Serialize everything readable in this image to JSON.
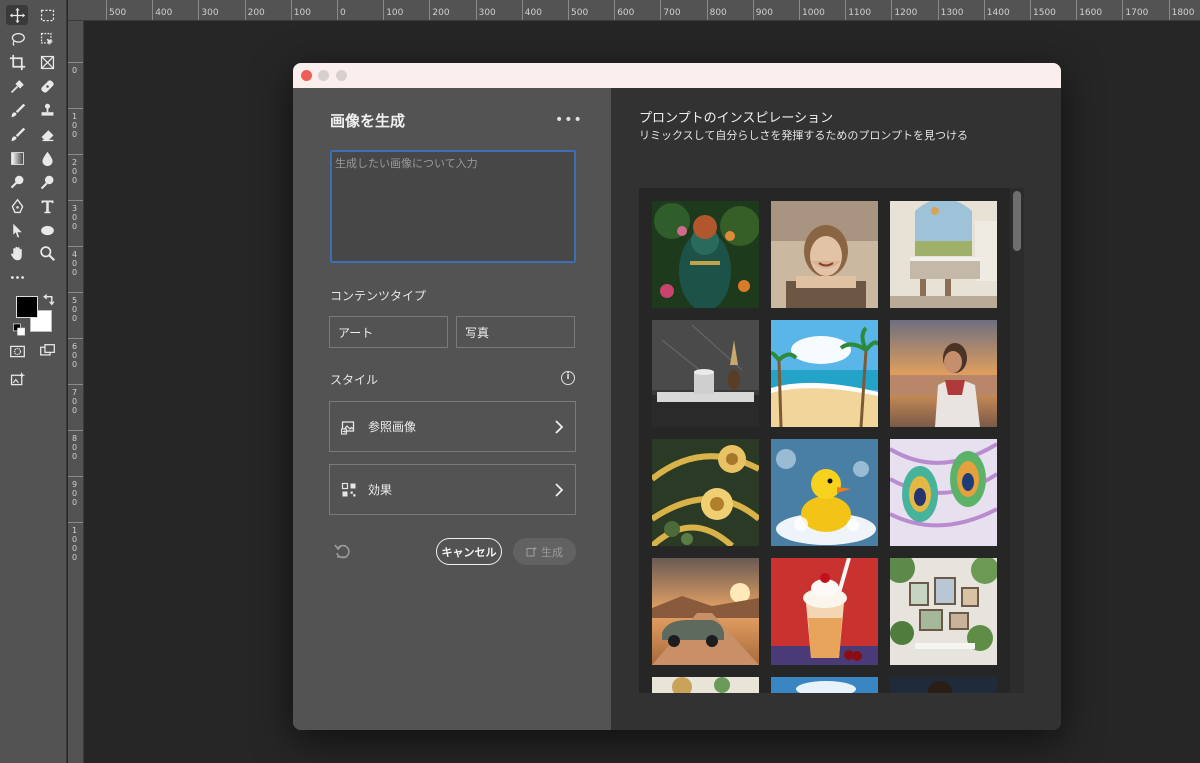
{
  "ruler": {
    "top_labels": [
      "500",
      "400",
      "300",
      "200",
      "100",
      "0",
      "100",
      "200",
      "300",
      "400",
      "500",
      "600",
      "700",
      "800",
      "900",
      "1000",
      "1100",
      "1200",
      "1300",
      "1400",
      "1500",
      "1600",
      "1700",
      "1800"
    ],
    "left_labels": [
      "0",
      "100",
      "200",
      "300",
      "400",
      "500",
      "600",
      "700",
      "800",
      "900",
      "1000"
    ]
  },
  "dialog": {
    "title": "画像を生成",
    "more_label": "•••",
    "prompt_placeholder": "生成したい画像について入力",
    "content_type_label": "コンテンツタイプ",
    "content_types": [
      "アート",
      "写真"
    ],
    "style_label": "スタイル",
    "info_icon_glyph": "i",
    "reference_image_label": "参照画像",
    "effects_label": "効果",
    "cancel_label": "キャンセル",
    "generate_label": "生成"
  },
  "inspiration": {
    "title": "プロンプトのインスピレーション",
    "subtitle": "リミックスして自分らしさを発揮するためのプロンプトを見つける",
    "tiles": [
      "jungle-goddess",
      "vintage-portrait-woman",
      "modern-kitchen",
      "marble-pedestal",
      "tropical-beach",
      "woman-at-beach-sunset",
      "golden-lotus-pattern",
      "rubber-duck-bubbles",
      "peacock-feather-pattern",
      "vintage-car-desert",
      "milkshake",
      "plant-wall-room",
      "partial-tile-1",
      "partial-tile-2",
      "partial-tile-3"
    ]
  },
  "colors": {
    "accent_focus": "#3c6fb3",
    "window_close": "#ee5e55",
    "foreground_swatch": "#000000",
    "background_swatch": "#ffffff"
  }
}
